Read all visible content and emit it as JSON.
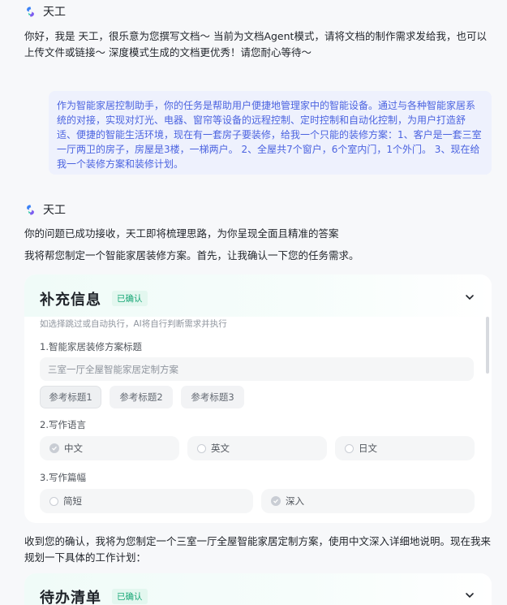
{
  "bot": {
    "name": "天工"
  },
  "greeting": "你好，我是 天工，很乐意为您撰写文档～ 当前为文档Agent模式，请将文档的制作需求发给我，也可以上传文件或链接～ 深度模式生成的文档更优秀！请您耐心等待～",
  "user_message": "作为智能家居控制助手，你的任务是帮助用户便捷地管理家中的智能设备。通过与各种智能家居系统的对接，实现对灯光、电器、窗帘等设备的远程控制、定时控制和自动化控制，为用户打造舒适、便捷的智能生活环境，现在有一套房子要装修，给我一个只能的装修方案：1、客户是一套三室一厅两卫的房子，房屋是3楼，一梯两户。 2、全屋共7个窗户，6个室内门，1个外门。 3、现在给我一个装修方案和装修计划。",
  "reply": {
    "line1": "你的问题已成功接收，天工即将梳理思路，为你呈现全面且精准的答案",
    "line2": "我将帮您制定一个智能家居装修方案。首先，让我确认一下您的任务需求。"
  },
  "supplement_card": {
    "title": "补充信息",
    "badge": "已确认",
    "hint": "如选择跳过或自动执行，AI将自行判断需求并执行",
    "section1": {
      "label": "1.智能家居装修方案标题",
      "input_value": "三室一厅全屋智能家居定制方案",
      "chips": [
        "参考标题1",
        "参考标题2",
        "参考标题3"
      ]
    },
    "section2": {
      "label": "2.写作语言",
      "options": [
        "中文",
        "英文",
        "日文"
      ],
      "selected": "中文"
    },
    "section3": {
      "label": "3.写作篇幅",
      "options": [
        "简短",
        "深入"
      ],
      "selected": "深入"
    }
  },
  "confirm_text": "收到您的确认，我将为您制定一个三室一厅全屋智能家居定制方案，使用中文深入详细地说明。现在我来规划一下具体的工作计划：",
  "todo_card": {
    "title": "待办清单",
    "badge": "已确认"
  }
}
